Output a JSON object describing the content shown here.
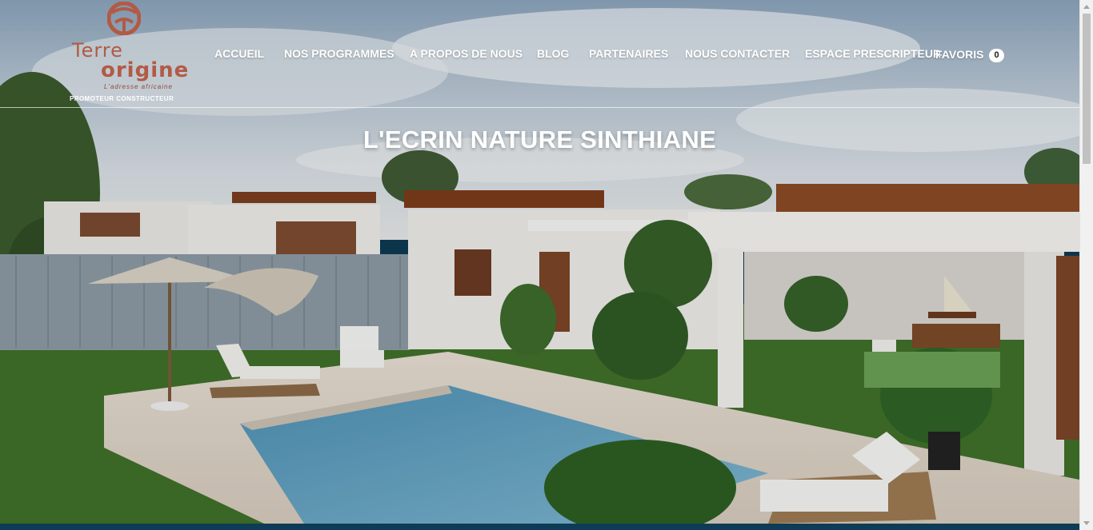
{
  "logo": {
    "line1": "Terre",
    "line2": "origine",
    "tagline": "L'adresse africaine",
    "subtitle": "PROMOTEUR CONSTRUCTEUR"
  },
  "nav": {
    "items": [
      {
        "label": "ACCUEIL"
      },
      {
        "label": "NOS PROGRAMMES"
      },
      {
        "label": "A PROPOS DE NOUS"
      },
      {
        "label": "BLOG"
      },
      {
        "label": "PARTENAIRES"
      },
      {
        "label": "NOUS CONTACTER"
      },
      {
        "label": "ESPACE PRESCRIPTEUR"
      }
    ],
    "favoris_label": "FAVORIS",
    "favoris_count": "0"
  },
  "hero": {
    "title": "L'ECRIN NATURE SINTHIANE"
  },
  "colors": {
    "brand": "#b25a45",
    "nav_text": "#ffffff",
    "footer_strip": "#0e3b55"
  }
}
